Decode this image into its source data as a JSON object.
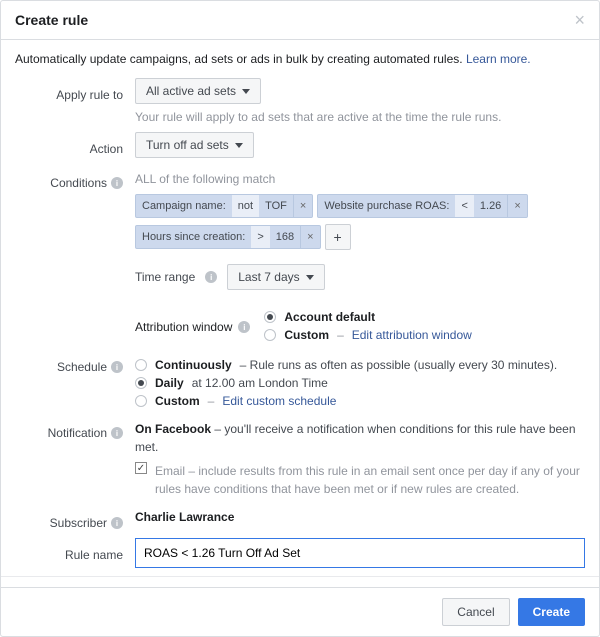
{
  "header": {
    "title": "Create rule"
  },
  "subtitle": {
    "text": "Automatically update campaigns, ad sets or ads in bulk by creating automated rules.",
    "link": "Learn more."
  },
  "labels": {
    "apply_rule_to": "Apply rule to",
    "action": "Action",
    "conditions": "Conditions",
    "schedule": "Schedule",
    "notification": "Notification",
    "subscriber": "Subscriber",
    "rule_name": "Rule name"
  },
  "apply_rule_to": {
    "value": "All active ad sets",
    "help": "Your rule will apply to ad sets that are active at the time the rule runs."
  },
  "action": {
    "value": "Turn off ad sets"
  },
  "conditions": {
    "header": "ALL of the following match",
    "chips": [
      {
        "field": "Campaign name:",
        "op": "not",
        "val": "TOF"
      },
      {
        "field": "Website purchase ROAS:",
        "op": "<",
        "val": "1.26"
      },
      {
        "field": "Hours since creation:",
        "op": ">",
        "val": "168"
      }
    ],
    "time_range": {
      "label": "Time range",
      "value": "Last 7 days"
    },
    "attribution": {
      "label": "Attribution window",
      "options": {
        "account_default": "Account default",
        "custom": "Custom",
        "custom_link": "Edit attribution window"
      },
      "selected": "account_default"
    }
  },
  "schedule": {
    "continuously": {
      "label": "Continuously",
      "desc": "– Rule runs as often as possible (usually every 30 minutes)."
    },
    "daily": {
      "label": "Daily",
      "desc": "at 12.00 am London Time"
    },
    "custom": {
      "label": "Custom",
      "link": "Edit custom schedule"
    },
    "selected": "daily"
  },
  "notification": {
    "fb_label": "On Facebook",
    "fb_desc": "– you'll receive a notification when conditions for this rule have been met.",
    "email_label": "Email",
    "email_desc": "– include results from this rule in an email sent once per day if any of your rules have conditions that have been met or if new rules are created.",
    "email_checked": true
  },
  "subscriber": {
    "name": "Charlie Lawrance"
  },
  "rule_name": {
    "value": "ROAS < 1.26 Turn Off Ad Set"
  },
  "footer": {
    "cancel": "Cancel",
    "create": "Create"
  }
}
